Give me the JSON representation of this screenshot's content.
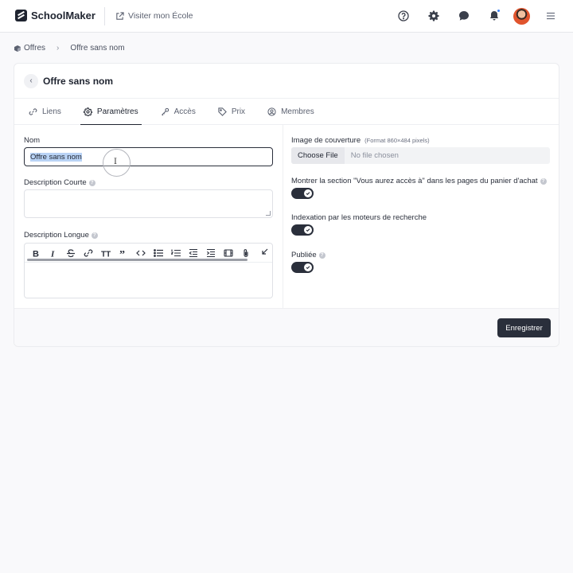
{
  "topbar": {
    "logo": "SchoolMaker",
    "visit_link": "Visiter mon École",
    "icons": [
      "help-icon",
      "gear-icon",
      "chat-icon",
      "bell-icon",
      "avatar",
      "menu-icon"
    ],
    "accent_color": "#3b82f6"
  },
  "breadcrumb": {
    "root": "Offres",
    "current": "Offre sans nom"
  },
  "card": {
    "title": "Offre sans nom",
    "tabs": [
      {
        "label": "Liens",
        "icon": "link-icon",
        "active": false
      },
      {
        "label": "Paramètres",
        "icon": "gear-icon",
        "active": true
      },
      {
        "label": "Accès",
        "icon": "key-icon",
        "active": false
      },
      {
        "label": "Prix",
        "icon": "tag-icon",
        "active": false
      },
      {
        "label": "Membres",
        "icon": "user-circle-icon",
        "active": false
      }
    ]
  },
  "form": {
    "name_label": "Nom",
    "name_value": "Offre sans nom",
    "short_desc_label": "Description Courte",
    "short_desc_value": "",
    "long_desc_label": "Description Longue",
    "long_desc_toolbar": [
      "bold",
      "italic",
      "strikethrough",
      "link",
      "heading",
      "quote",
      "code",
      "bullet-list",
      "numbered-list",
      "outdent",
      "indent",
      "media",
      "attach",
      "collapse"
    ],
    "cover_label": "Image de couverture",
    "cover_hint": "(Format 860×484 pixels)",
    "file_button": "Choose File",
    "file_status": "No file chosen",
    "show_section_label": "Montrer la section \"Vous aurez accès à\" dans les pages du panier d'achat",
    "show_section_on": true,
    "indexing_label": "Indexation par les moteurs de recherche",
    "indexing_on": true,
    "published_label": "Publiée",
    "published_on": true,
    "help_glyph": "?"
  },
  "footer": {
    "save_label": "Enregistrer"
  }
}
